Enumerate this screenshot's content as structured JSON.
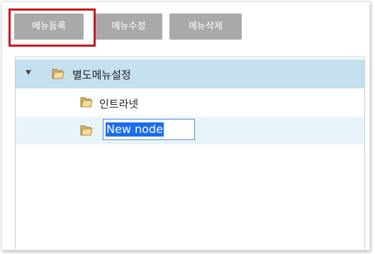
{
  "toolbar": {
    "register_label": "메뉴등록",
    "edit_label": "메뉴수정",
    "delete_label": "메뉴삭제"
  },
  "tree": {
    "root": {
      "label": "별도메뉴설정",
      "expanded": true,
      "icon": "folder-icon"
    },
    "children": [
      {
        "label": "인트라넷",
        "icon": "folder-icon"
      },
      {
        "label": "New node",
        "icon": "folder-icon",
        "editing": true
      }
    ]
  },
  "colors": {
    "button_bg": "#a9a9a9",
    "highlight_border": "#c8181a",
    "selected_row": "#c5e0ef",
    "hover_row": "#e8f3fa",
    "text_selection": "#1a6cf0"
  }
}
